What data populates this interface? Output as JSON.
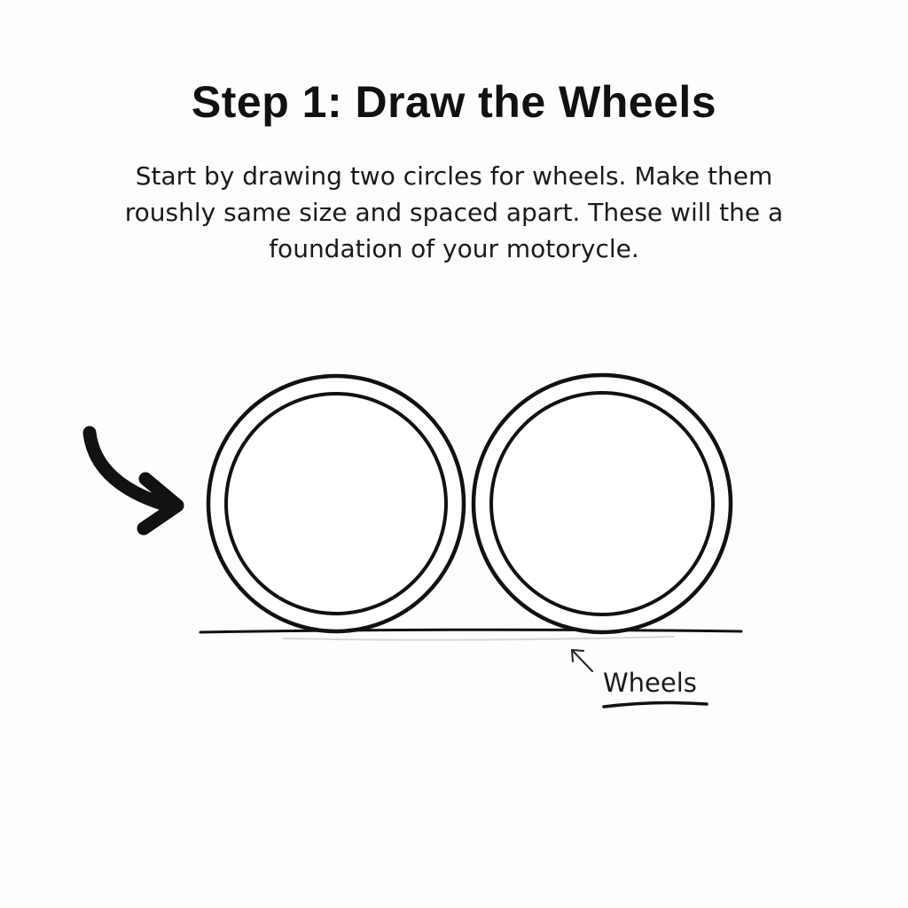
{
  "heading": {
    "title": "Step 1: Draw the Wheels"
  },
  "instructions": {
    "lines": [
      "Start by drawing two circles for wheels. Make them",
      "roushly same size and spaced apart. These will the a",
      "foundation of your motorycle."
    ]
  },
  "illustration": {
    "label": "Wheels",
    "wheel_count": 2,
    "icons": [
      "curved-arrow-icon",
      "small-arrow-icon"
    ],
    "colors": {
      "ink": "#111111",
      "background": "#fdfdfd"
    }
  }
}
